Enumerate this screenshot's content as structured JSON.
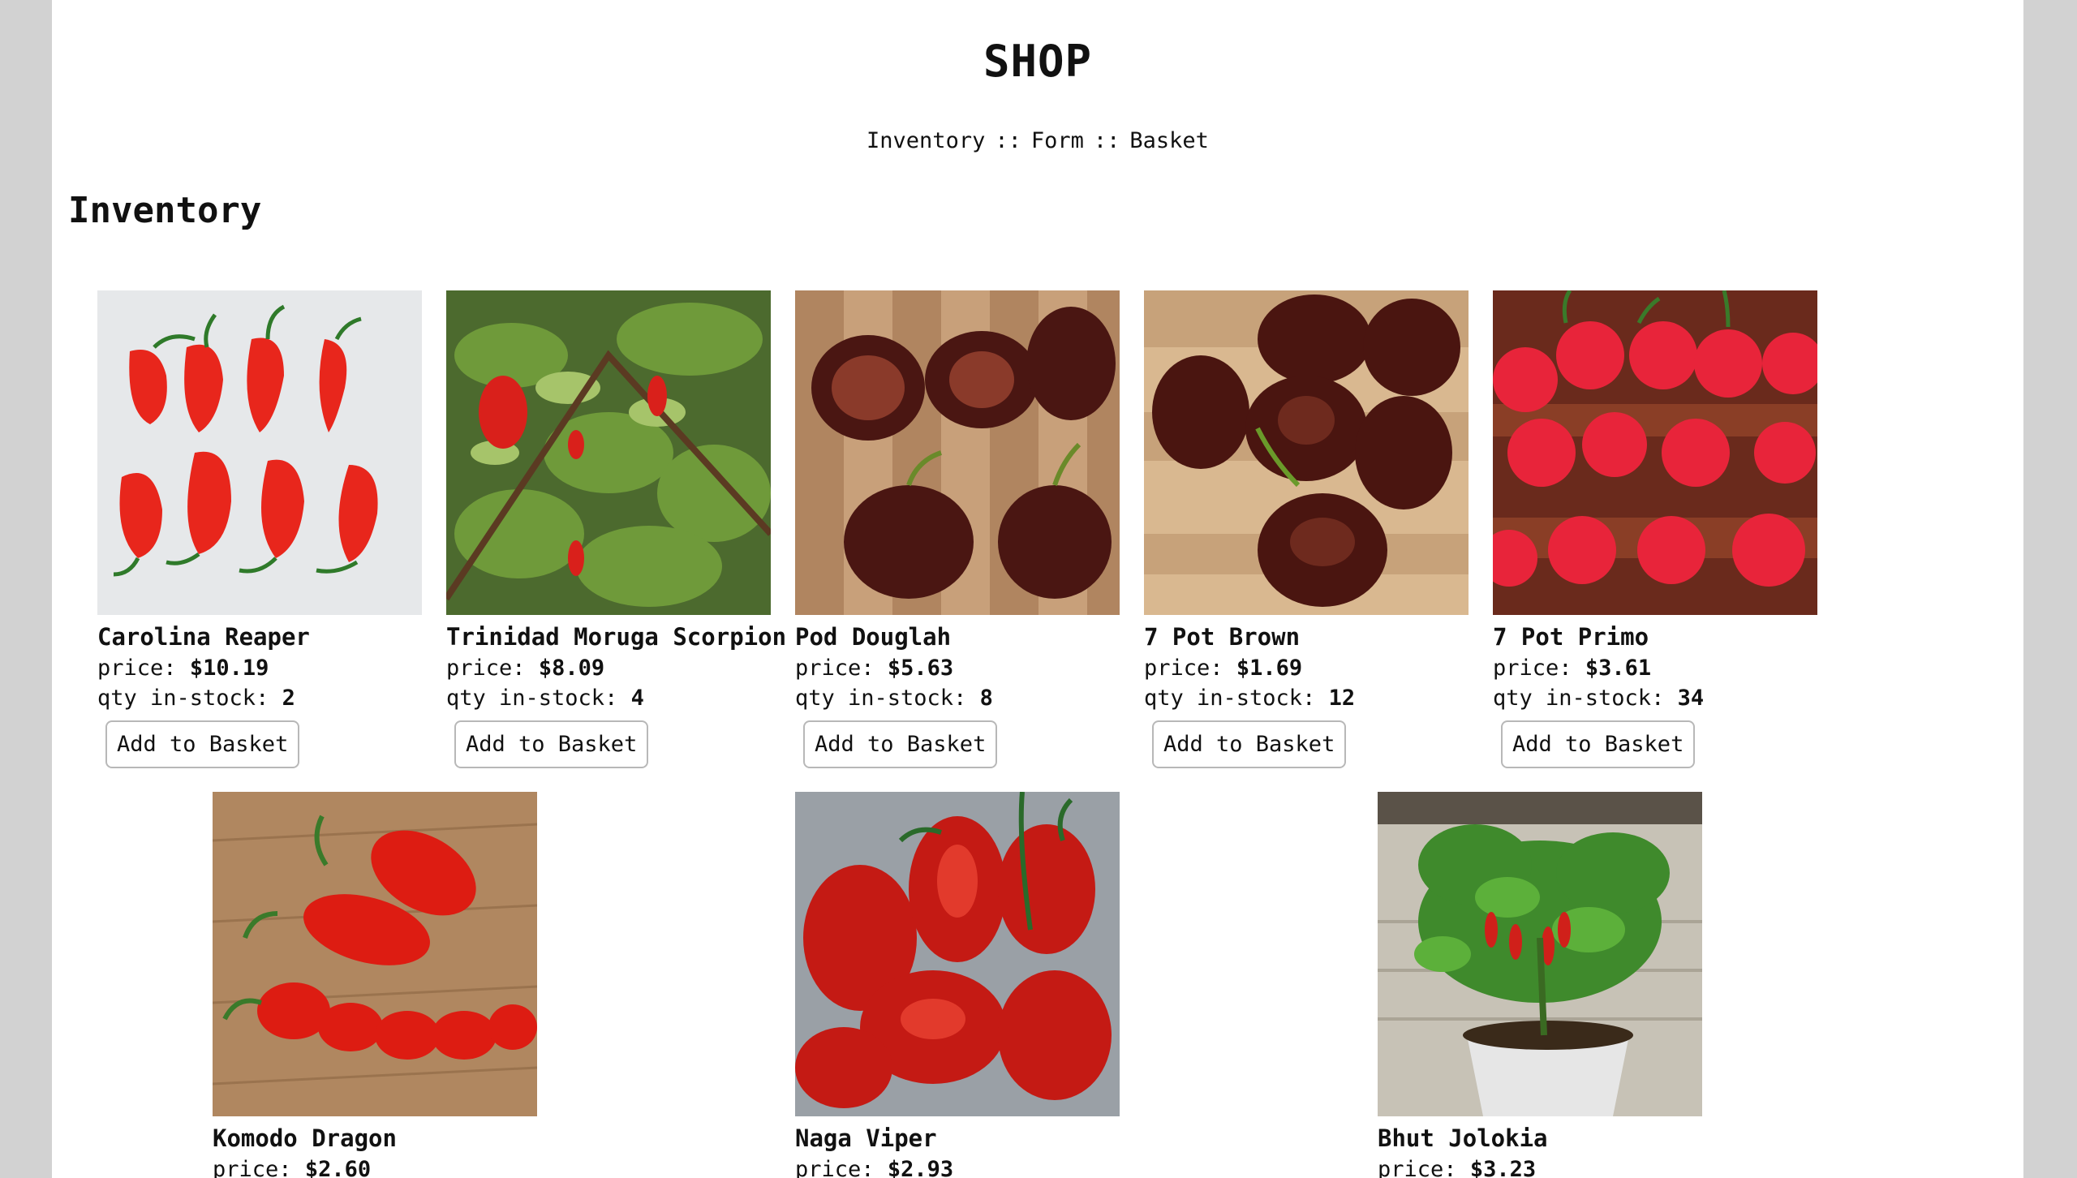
{
  "header": {
    "title": "SHOP",
    "nav": [
      "Inventory",
      "Form",
      "Basket"
    ],
    "separator": "::"
  },
  "section_title": "Inventory",
  "labels": {
    "price": "price:",
    "qty": "qty in-stock:",
    "add": "Add to Basket"
  },
  "products": [
    {
      "name": "Carolina Reaper",
      "price": "$10.19",
      "qty": "2"
    },
    {
      "name": "Trinidad Moruga Scorpion",
      "price": "$8.09",
      "qty": "4"
    },
    {
      "name": "Pod Douglah",
      "price": "$5.63",
      "qty": "8"
    },
    {
      "name": "7 Pot Brown",
      "price": "$1.69",
      "qty": "12"
    },
    {
      "name": "7 Pot Primo",
      "price": "$3.61",
      "qty": "34"
    },
    {
      "name": "Komodo Dragon",
      "price": "$2.60"
    },
    {
      "name": "Naga Viper",
      "price": "$2.93"
    },
    {
      "name": "Bhut Jolokia",
      "price": "$3.23"
    }
  ],
  "colors": {
    "page_bg": "#ffffff",
    "frame_bg": "#d2d2d2",
    "button_border": "#b8b8b8"
  }
}
